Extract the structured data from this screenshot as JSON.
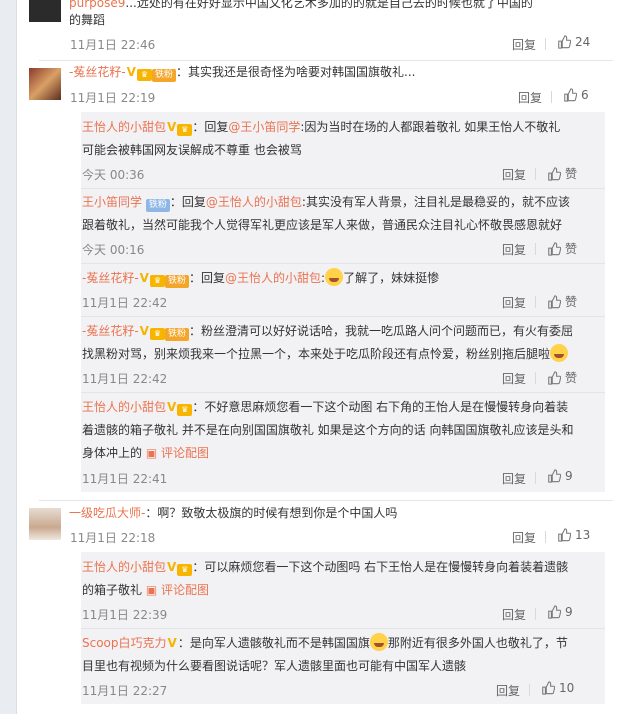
{
  "labels": {
    "reply": "回复",
    "like_zan": "赞",
    "comment_pic": "评论配图"
  },
  "c1": {
    "username": "purpose9",
    "text": "...远处的有在好好显示中国文化艺术多加的的就是自己去的时候也就了中国的",
    "text2": "的舞蹈",
    "time": "11月1日 22:46",
    "likes": "24"
  },
  "c2": {
    "username": "-菟丝花籽-",
    "fan_badge": "铁粉",
    "text": "其实我还是很奇怪为啥要对韩国国旗敬礼...",
    "time": "11月1日 22:19",
    "likes": "6",
    "subs": [
      {
        "username": "王怡人的小甜包",
        "prefix": "回复",
        "mention": "@王小笛同学",
        "text": "因为当时在场的人都跟着敬礼 如果王怡人不敬礼",
        "text2": "可能会被韩国网友误解成不尊重 也会被骂",
        "time": "今天 00:36"
      },
      {
        "username": "王小笛同学",
        "fan_badge": "铁粉",
        "prefix": "回复",
        "mention": "@王怡人的小甜包",
        "text": "其实没有军人背景，注目礼是最稳妥的，就不应该",
        "text2": "跟着敬礼，当然可能我个人觉得军礼更应该是军人来做，普通民众注目礼心怀敬畏感恩就好",
        "time": "今天 00:16"
      },
      {
        "username": "-菟丝花籽-",
        "fan_badge": "铁粉",
        "prefix": "回复",
        "mention": "@王怡人的小甜包",
        "text": "了解了，妹妹挺惨",
        "time": "11月1日 22:42"
      },
      {
        "username": "-菟丝花籽-",
        "fan_badge": "铁粉",
        "text": "粉丝澄清可以好好说话哈，我就一吃瓜路人问个问题而已，有火有委屈",
        "text2": "找黑粉对骂，别来烦我来一个拉黑一个，本来处于吃瓜阶段还有点怜爱，粉丝别拖后腿啦",
        "time": "11月1日 22:42"
      },
      {
        "username": "王怡人的小甜包",
        "text": "不好意思麻烦您看一下这个动图 右下角的王怡人是在慢慢转身向着装",
        "text2": "着遗骸的箱子敬礼 并不是在向别国国旗敬礼 如果是这个方向的话 向韩国国旗敬礼应该是头和",
        "text3": "身体冲上的",
        "time": "11月1日 22:41",
        "likes": "9"
      }
    ]
  },
  "c3": {
    "username": "一级吃瓜大师-",
    "text": "啊？致敬太极旗的时候有想到你是个中国人吗",
    "time": "11月1日 22:18",
    "likes": "13",
    "subs": [
      {
        "username": "王怡人的小甜包",
        "text": "可以麻烦您看一下这个动图吗 右下王怡人是在慢慢转身向着装着遗骸",
        "text2": "的箱子敬礼",
        "time": "11月1日 22:39",
        "likes": "9"
      },
      {
        "username": "Scoop白巧克力",
        "text": "是向军人遗骸敬礼而不是韩国国旗",
        "text_b": "那附近有很多外国人也敬礼了，节",
        "text2": "目里也有视频为什么要看图说话呢？军人遗骸里面也可能有中国军人遗骸",
        "time": "11月1日 22:27",
        "likes": "10"
      }
    ]
  }
}
